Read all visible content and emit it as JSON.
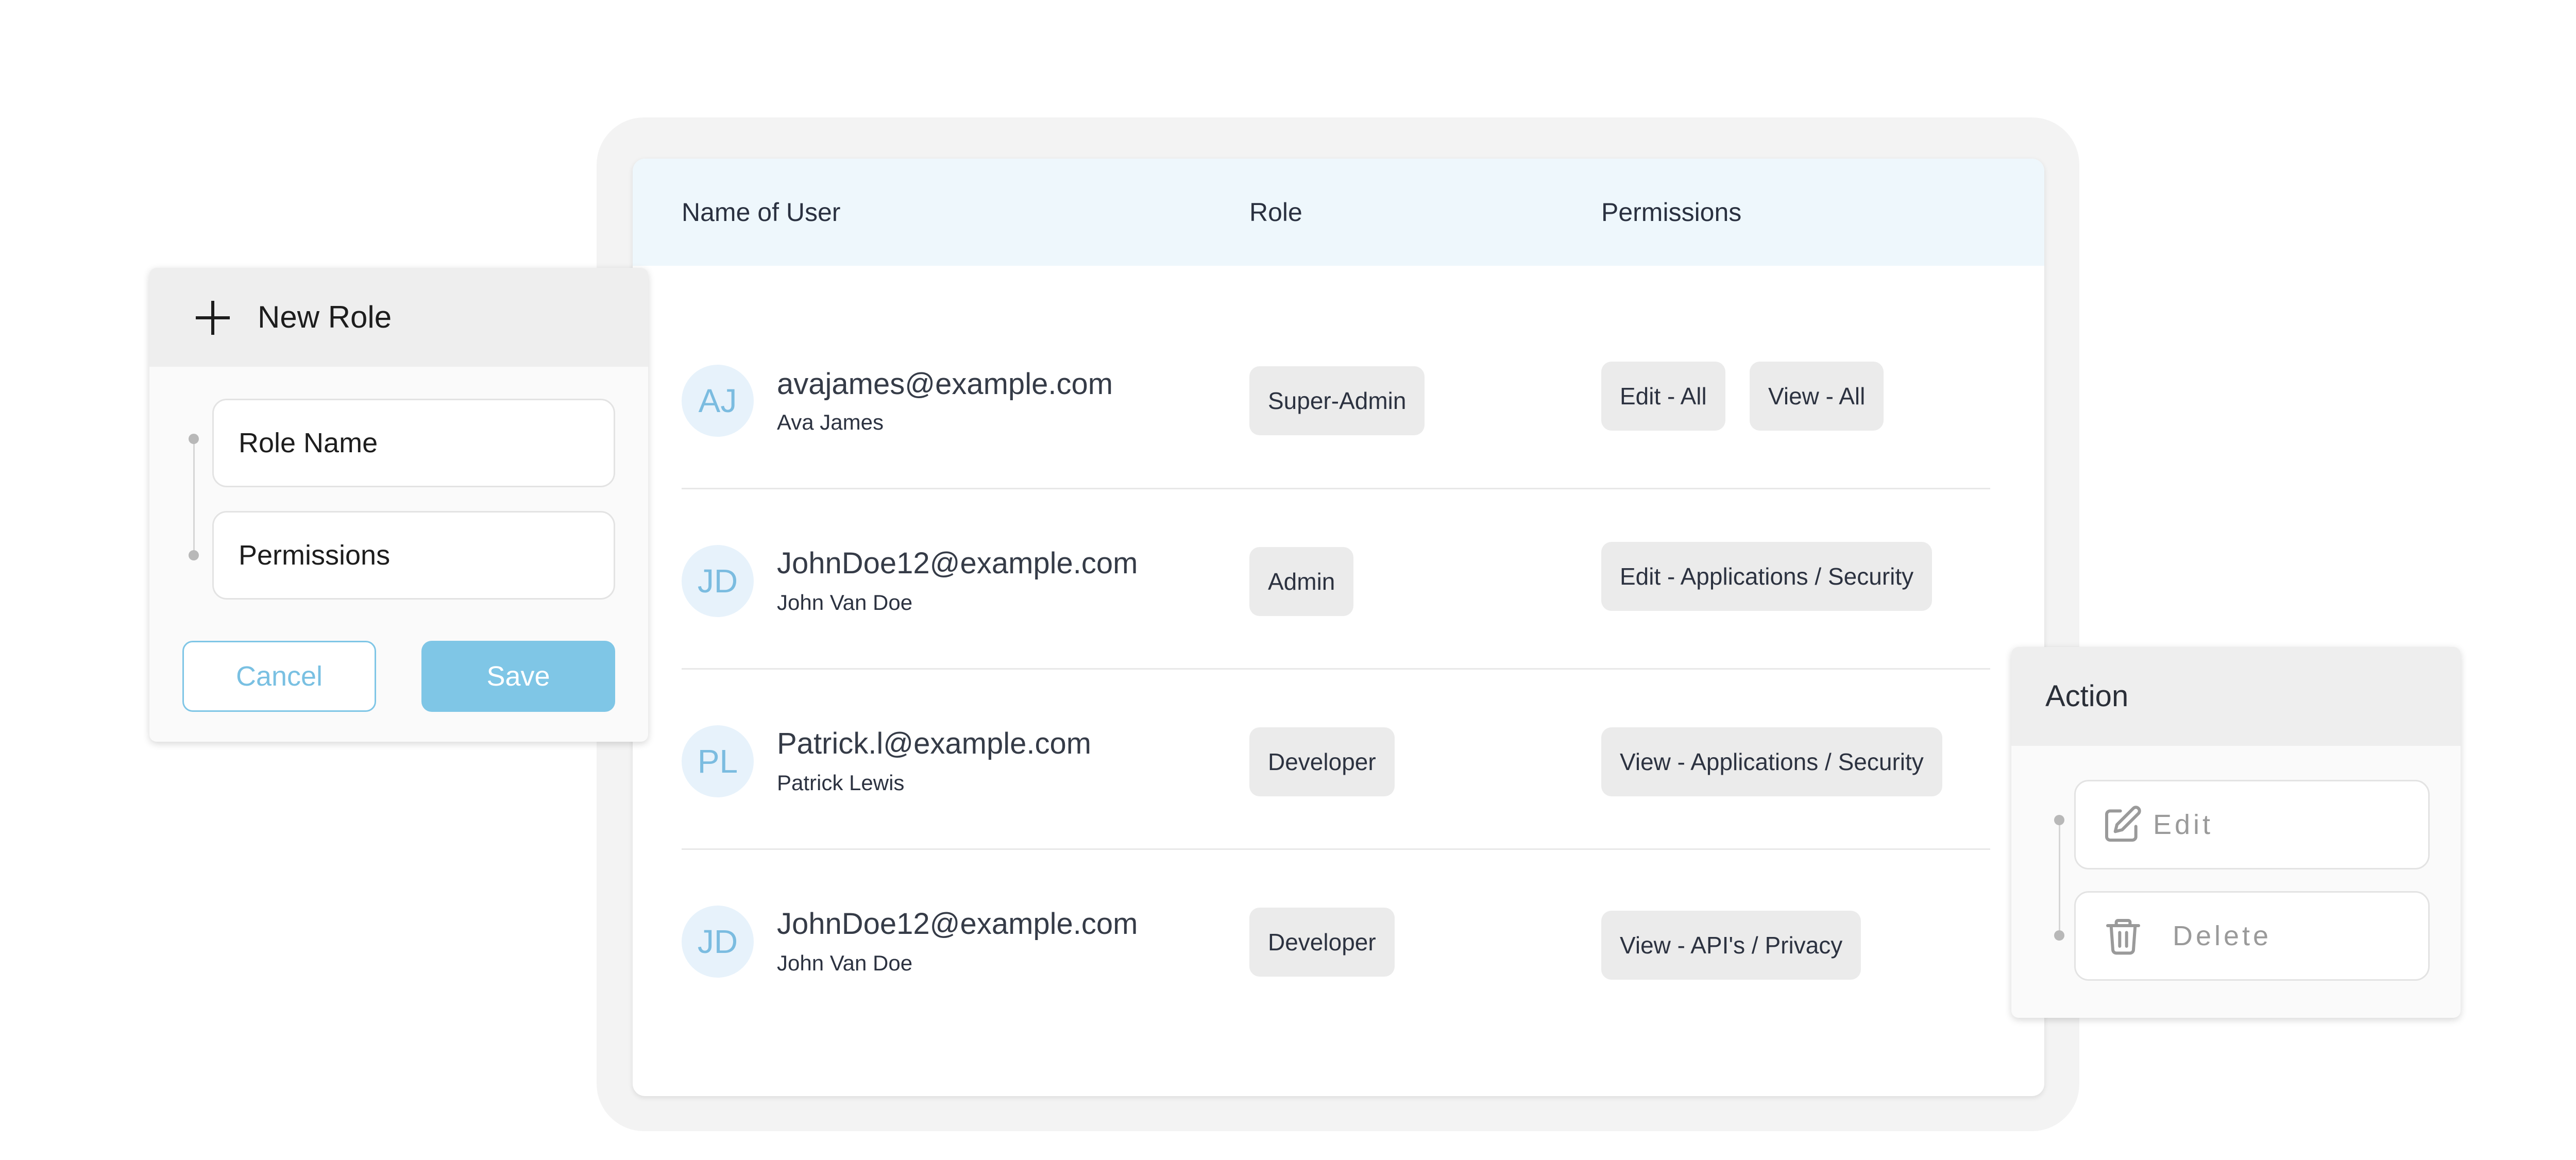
{
  "table": {
    "columns": {
      "name": "Name of User",
      "role": "Role",
      "permissions": "Permissions"
    },
    "rows": [
      {
        "initials": "AJ",
        "email": "avajames@example.com",
        "name": "Ava James",
        "role": "Super-Admin",
        "permissions": [
          "Edit - All",
          "View - All"
        ]
      },
      {
        "initials": "JD",
        "email": "JohnDoe12@example.com",
        "name": "John Van Doe",
        "role": "Admin",
        "permissions": [
          "Edit - Applications / Security"
        ]
      },
      {
        "initials": "PL",
        "email": "Patrick.l@example.com",
        "name": "Patrick Lewis",
        "role": "Developer",
        "permissions": [
          "View - Applications / Security"
        ]
      },
      {
        "initials": "JD",
        "email": "JohnDoe12@example.com",
        "name": "John Van Doe",
        "role": "Developer",
        "permissions": [
          "View - API's / Privacy"
        ]
      }
    ]
  },
  "new_role_panel": {
    "title": "New Role",
    "title_icon": "plus-icon",
    "fields": {
      "role_name": "Role Name",
      "permissions": "Permissions"
    },
    "cancel_label": "Cancel",
    "save_label": "Save"
  },
  "action_panel": {
    "title": "Action",
    "edit_label": "Edit",
    "edit_icon": "edit-icon",
    "delete_label": "Delete",
    "delete_icon": "trash-icon"
  },
  "colors": {
    "accent": "#7fc6e6",
    "header_bg": "#eef7fc",
    "avatar_bg": "#e7f2fb",
    "avatar_text": "#7bbce0",
    "pill_bg": "#ebebeb"
  }
}
